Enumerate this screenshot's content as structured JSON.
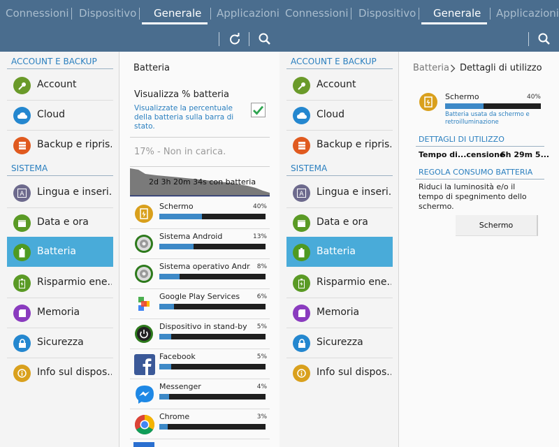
{
  "tabs": [
    "Connessioni",
    "Dispositivo",
    "Generale",
    "Applicazioni"
  ],
  "sidebar": {
    "section1": "ACCOUNT E BACKUP",
    "items1": [
      {
        "label": "Account",
        "icon": "key-icon",
        "color": "#6a9a2a"
      },
      {
        "label": "Cloud",
        "icon": "cloud-icon",
        "color": "#2487cf"
      },
      {
        "label": "Backup e ripris..",
        "icon": "backup-icon",
        "color": "#e05a1f"
      }
    ],
    "section2": "SISTEMA",
    "items2": [
      {
        "label": "Lingua e inseri..",
        "icon": "language-icon",
        "color": "#6d6a8d"
      },
      {
        "label": "Data e ora",
        "icon": "calendar-icon",
        "color": "#5a9a25"
      },
      {
        "label": "Batteria",
        "icon": "battery-icon",
        "color": "#4f9a22"
      },
      {
        "label": "Risparmio ene..",
        "icon": "power-saving-icon",
        "color": "#5a9a25"
      },
      {
        "label": "Memoria",
        "icon": "memory-icon",
        "color": "#8a3bbf"
      },
      {
        "label": "Sicurezza",
        "icon": "lock-icon",
        "color": "#2487cf"
      },
      {
        "label": "Info sul dispos..",
        "icon": "info-icon",
        "color": "#d9a01d"
      }
    ]
  },
  "battery": {
    "title": "Batteria",
    "show_pct_title": "Visualizza % batteria",
    "show_pct_desc": "Visualizzate la percentuale della batteria sulla barra di stato.",
    "show_pct_checked": true,
    "status": "17% - Non in carica.",
    "graph_label": "2d 3h 20m 34s con batteria",
    "apps": [
      {
        "name": "Schermo",
        "pct": "40%",
        "fill": 0.4,
        "icon": "screen-icon"
      },
      {
        "name": "Sistema Android",
        "pct": "13%",
        "fill": 0.32,
        "icon": "android-system-icon"
      },
      {
        "name": "Sistema operativo Andr..",
        "pct": "8%",
        "fill": 0.19,
        "icon": "android-os-icon"
      },
      {
        "name": "Google Play Services",
        "pct": "6%",
        "fill": 0.14,
        "icon": "play-services-icon"
      },
      {
        "name": "Dispositivo in stand-by",
        "pct": "5%",
        "fill": 0.11,
        "icon": "standby-icon"
      },
      {
        "name": "Facebook",
        "pct": "5%",
        "fill": 0.11,
        "icon": "facebook-icon"
      },
      {
        "name": "Messenger",
        "pct": "4%",
        "fill": 0.09,
        "icon": "messenger-icon"
      },
      {
        "name": "Chrome",
        "pct": "3%",
        "fill": 0.08,
        "icon": "chrome-icon"
      }
    ]
  },
  "detail": {
    "breadcrumb_parent": "Batteria",
    "breadcrumb_current": "Dettagli di utilizzo",
    "app_name": "Schermo",
    "app_pct": "40%",
    "app_fill": 0.4,
    "app_desc": "Batteria usata da schermo e retroilluminazione",
    "usage_head": "DETTAGLI DI UTILIZZO",
    "usage_label": "Tempo di...censione",
    "usage_value": "6h 29m 5...",
    "adjust_head": "REGOLA CONSUMO BATTERIA",
    "adjust_text": "Riduci la luminosità e/o il tempo di spegnimento dello schermo.",
    "button_label": "Schermo"
  },
  "colors": {
    "topbar": "#4a6d8e",
    "accent": "#2a7fbf",
    "selected": "#49abd9",
    "bar_fill": "#3d89c7"
  }
}
